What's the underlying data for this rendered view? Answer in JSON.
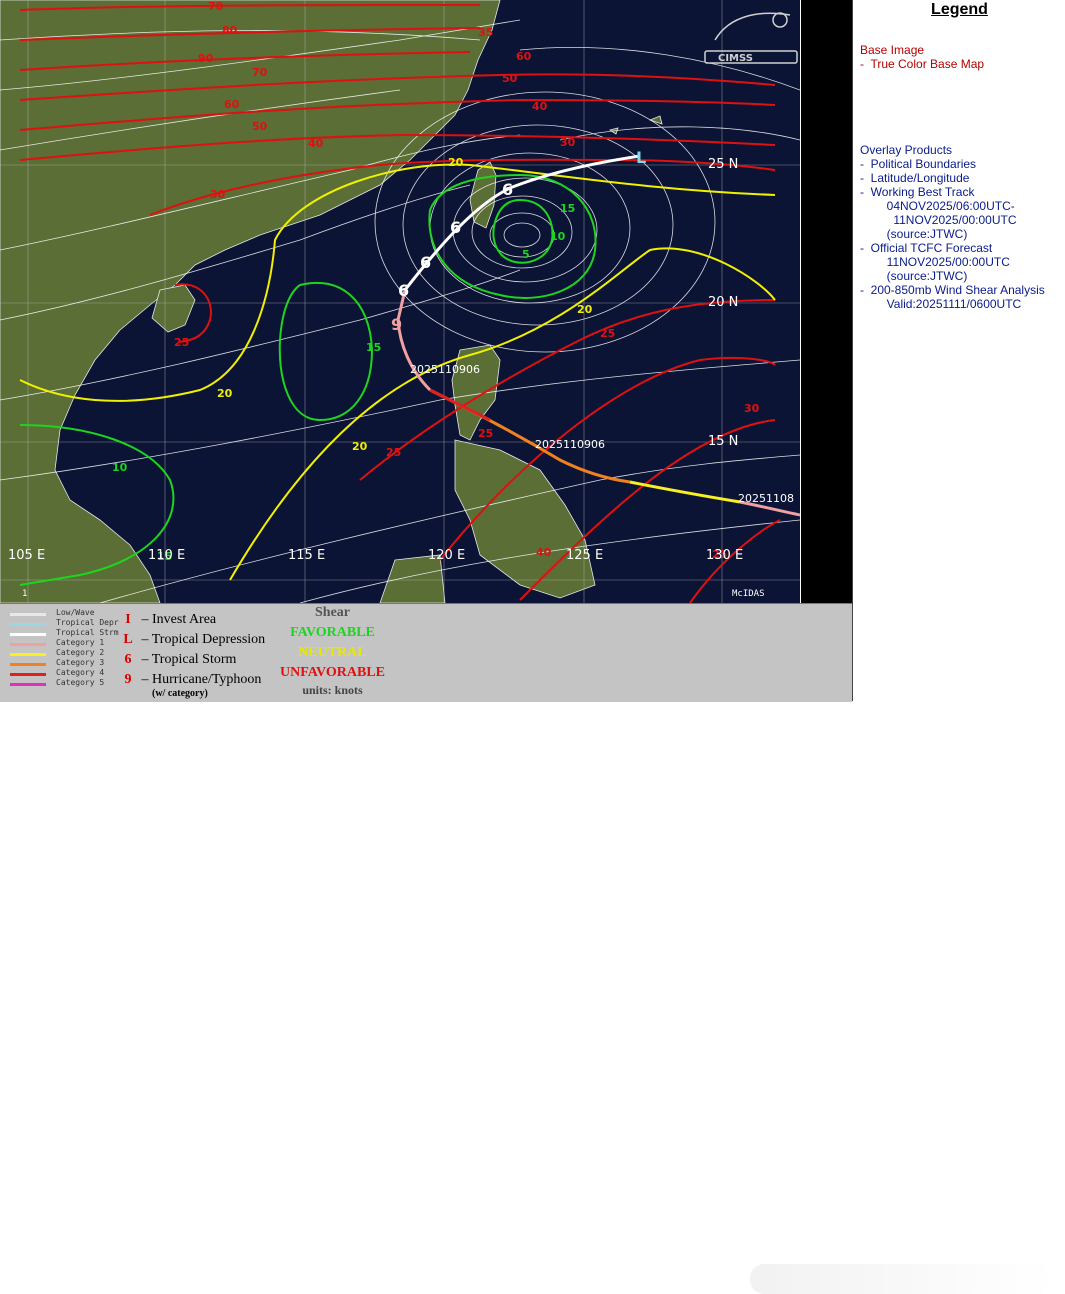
{
  "map": {
    "lat_labels": [
      "25 N",
      "20 N",
      "15 N"
    ],
    "lon_labels": [
      "105 E",
      "110 E",
      "115 E",
      "120 E",
      "125 E",
      "130 E"
    ],
    "shear_contour_labels": [
      "70",
      "80",
      "90",
      "70",
      "60",
      "50",
      "40",
      "30",
      "25",
      "35",
      "60",
      "50",
      "40",
      "30",
      "20",
      "15",
      "10",
      "5",
      "20",
      "25",
      "30",
      "25",
      "20",
      "15",
      "20",
      "25",
      "30",
      "10",
      "15",
      "40",
      "25"
    ],
    "track_date_labels": [
      "2025110906",
      "2025110906",
      "20251108"
    ],
    "corner_left": "1",
    "corner_right": "McIDAS",
    "logo_text": "CIMSS"
  },
  "legend": {
    "title": "Legend",
    "base_image_heading": "Base Image",
    "base_image_item": "-  True Color Base Map",
    "overlay_heading": "Overlay Products",
    "overlay_items": [
      "-  Political Boundaries",
      "-  Latitude/Longitude",
      "-  Working Best Track",
      "        04NOV2025/06:00UTC-",
      "          11NOV2025/00:00UTC",
      "        (source:JTWC)",
      "-  Official TCFC Forecast",
      "        11NOV2025/00:00UTC",
      "        (source:JTWC)",
      "-  200-850mb Wind Shear Analysis",
      "        Valid:20251111/0600UTC"
    ]
  },
  "bottom_legend": {
    "track_types": [
      {
        "label": "Low/Wave",
        "color": "#e8e8e8"
      },
      {
        "label": "Tropical Depr",
        "color": "#9ad7e8"
      },
      {
        "label": "Tropical Strm",
        "color": "#ffffff"
      },
      {
        "label": "Category 1",
        "color": "#f0a0a0"
      },
      {
        "label": "Category 2",
        "color": "#f8f020"
      },
      {
        "label": "Category 3",
        "color": "#f08020"
      },
      {
        "label": "Category 4",
        "color": "#e02020"
      },
      {
        "label": "Category 5",
        "color": "#e030c0"
      }
    ],
    "symbols": [
      {
        "glyph": "I",
        "label": "– Invest Area"
      },
      {
        "glyph": "L",
        "label": "– Tropical Depression"
      },
      {
        "glyph": "6",
        "label": "– Tropical Storm"
      },
      {
        "glyph": "9",
        "label": "– Hurricane/Typhoon"
      }
    ],
    "symbols_note": "(w/ category)",
    "shear_title": "Shear",
    "favorable": "FAVORABLE",
    "neutral": "NEUTRAL",
    "unfavorable": "UNFAVORABLE",
    "units": "units: knots",
    "colors": {
      "favorable": "#1ed41e",
      "neutral": "#f0f000",
      "unfavorable": "#e01010"
    }
  }
}
